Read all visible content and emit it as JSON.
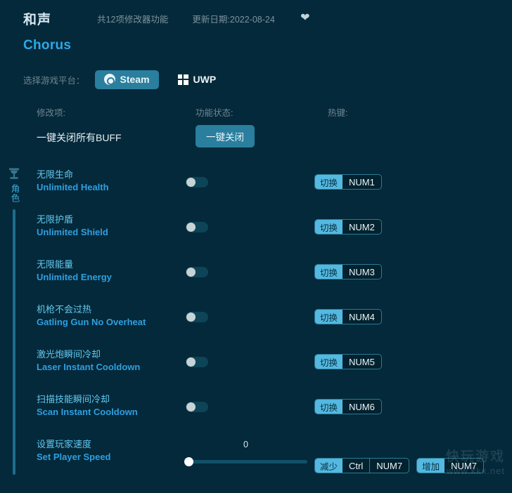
{
  "header": {
    "title_cn": "和声",
    "title_en": "Chorus",
    "feature_count_text": "共12项修改器功能",
    "update_date_text": "更新日期:2022-08-24",
    "favorite_icon": "heart-icon"
  },
  "platform": {
    "label": "选择游戏平台：",
    "options": [
      {
        "name": "Steam",
        "icon": "steam-icon",
        "selected": true
      },
      {
        "name": "UWP",
        "icon": "windows-icon",
        "selected": false
      }
    ]
  },
  "columns": {
    "modifier": "修改项:",
    "state": "功能状态:",
    "hotkey": "热键:"
  },
  "global": {
    "label": "一键关闭所有BUFF",
    "button": "一键关闭"
  },
  "sidebar": {
    "icon": "character-icon",
    "label": "角色"
  },
  "rows": [
    {
      "cn": "无限生命",
      "en": "Unlimited Health",
      "control": "toggle",
      "state": "off",
      "hotkeys": [
        {
          "action": "切换",
          "keys": [
            "NUM1"
          ]
        }
      ]
    },
    {
      "cn": "无限护盾",
      "en": "Unlimited Shield",
      "control": "toggle",
      "state": "off",
      "hotkeys": [
        {
          "action": "切换",
          "keys": [
            "NUM2"
          ]
        }
      ]
    },
    {
      "cn": "无限能量",
      "en": "Unlimited Energy",
      "control": "toggle",
      "state": "off",
      "hotkeys": [
        {
          "action": "切换",
          "keys": [
            "NUM3"
          ]
        }
      ]
    },
    {
      "cn": "机枪不会过热",
      "en": "Gatling Gun No Overheat",
      "control": "toggle",
      "state": "off",
      "hotkeys": [
        {
          "action": "切换",
          "keys": [
            "NUM4"
          ]
        }
      ]
    },
    {
      "cn": "激光炮瞬间冷却",
      "en": "Laser Instant Cooldown",
      "control": "toggle",
      "state": "off",
      "hotkeys": [
        {
          "action": "切换",
          "keys": [
            "NUM5"
          ]
        }
      ]
    },
    {
      "cn": "扫描技能瞬间冷却",
      "en": "Scan Instant Cooldown",
      "control": "toggle",
      "state": "off",
      "hotkeys": [
        {
          "action": "切换",
          "keys": [
            "NUM6"
          ]
        }
      ]
    },
    {
      "cn": "设置玩家速度",
      "en": "Set Player Speed",
      "control": "slider",
      "value": "0",
      "percent": 0,
      "hotkeys": [
        {
          "action": "减少",
          "keys": [
            "Ctrl",
            "NUM7"
          ]
        },
        {
          "action": "增加",
          "keys": [
            "NUM7"
          ]
        }
      ]
    }
  ],
  "watermark": {
    "brand": "快玩游戏",
    "url": "www.kkx.net"
  },
  "colors": {
    "background": "#04293a",
    "accent": "#2a7e9e",
    "hotkey_accent": "#54b8e0",
    "label_cn": "#63c8ef",
    "label_en": "#2f9fe0",
    "muted": "#6f858f"
  }
}
